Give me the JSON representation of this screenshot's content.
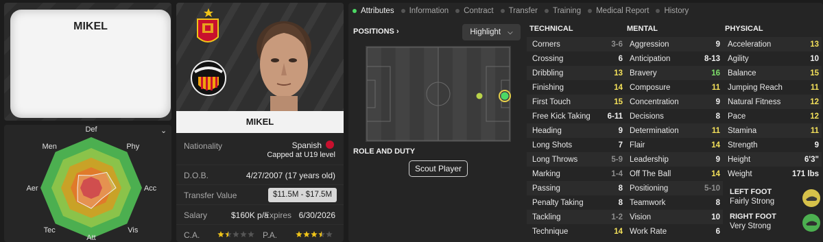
{
  "player": {
    "name": "MIKEL",
    "kit_name": "MIKEL"
  },
  "radar": {
    "labels": [
      "Def",
      "Phy",
      "Acc",
      "Vis",
      "Att",
      "Tec",
      "Aer",
      "Men"
    ]
  },
  "profile": {
    "nationality_label": "Nationality",
    "nationality_value": "Spanish",
    "nationality_note": "Capped at U19 level",
    "dob_label": "D.O.B.",
    "dob_value": "4/27/2007 (17 years old)",
    "transfer_label": "Transfer Value",
    "transfer_value": "$11.5M - $17.5M",
    "salary_label": "Salary",
    "salary_value": "$160K p/a",
    "expires_label": "Expires",
    "expires_value": "6/30/2026",
    "ca_label": "C.A.",
    "ca_stars": 1.5,
    "pa_label": "P.A.",
    "pa_stars": 3.5
  },
  "tabs": [
    "Attributes",
    "Information",
    "Contract",
    "Transfer",
    "Training",
    "Medical Report",
    "History"
  ],
  "active_tab": "Attributes",
  "positions": {
    "title": "POSITIONS",
    "highlight_label": "Highlight"
  },
  "role": {
    "title": "ROLE AND DUTY",
    "scout_label": "Scout Player"
  },
  "technical": {
    "title": "TECHNICAL",
    "rows": [
      {
        "name": "Corners",
        "value": "3-6",
        "tone": "grey"
      },
      {
        "name": "Crossing",
        "value": "6",
        "tone": "white"
      },
      {
        "name": "Dribbling",
        "value": "13",
        "tone": "yellow"
      },
      {
        "name": "Finishing",
        "value": "14",
        "tone": "yellow"
      },
      {
        "name": "First Touch",
        "value": "15",
        "tone": "yellow"
      },
      {
        "name": "Free Kick Taking",
        "value": "6-11",
        "tone": "white"
      },
      {
        "name": "Heading",
        "value": "9",
        "tone": "white"
      },
      {
        "name": "Long Shots",
        "value": "7",
        "tone": "white"
      },
      {
        "name": "Long Throws",
        "value": "5-9",
        "tone": "grey"
      },
      {
        "name": "Marking",
        "value": "1-4",
        "tone": "grey"
      },
      {
        "name": "Passing",
        "value": "8",
        "tone": "white"
      },
      {
        "name": "Penalty Taking",
        "value": "8",
        "tone": "white"
      },
      {
        "name": "Tackling",
        "value": "1-2",
        "tone": "grey"
      },
      {
        "name": "Technique",
        "value": "14",
        "tone": "yellow"
      }
    ]
  },
  "mental": {
    "title": "MENTAL",
    "rows": [
      {
        "name": "Aggression",
        "value": "9",
        "tone": "white"
      },
      {
        "name": "Anticipation",
        "value": "8-13",
        "tone": "white"
      },
      {
        "name": "Bravery",
        "value": "16",
        "tone": "green"
      },
      {
        "name": "Composure",
        "value": "11",
        "tone": "yellow"
      },
      {
        "name": "Concentration",
        "value": "9",
        "tone": "white"
      },
      {
        "name": "Decisions",
        "value": "8",
        "tone": "white"
      },
      {
        "name": "Determination",
        "value": "11",
        "tone": "yellow"
      },
      {
        "name": "Flair",
        "value": "14",
        "tone": "yellow"
      },
      {
        "name": "Leadership",
        "value": "9",
        "tone": "white"
      },
      {
        "name": "Off The Ball",
        "value": "14",
        "tone": "yellow"
      },
      {
        "name": "Positioning",
        "value": "5-10",
        "tone": "grey"
      },
      {
        "name": "Teamwork",
        "value": "8",
        "tone": "white"
      },
      {
        "name": "Vision",
        "value": "10",
        "tone": "white"
      },
      {
        "name": "Work Rate",
        "value": "6",
        "tone": "white"
      }
    ]
  },
  "physical": {
    "title": "PHYSICAL",
    "rows": [
      {
        "name": "Acceleration",
        "value": "13",
        "tone": "yellow"
      },
      {
        "name": "Agility",
        "value": "10",
        "tone": "white"
      },
      {
        "name": "Balance",
        "value": "15",
        "tone": "yellow"
      },
      {
        "name": "Jumping Reach",
        "value": "11",
        "tone": "yellow"
      },
      {
        "name": "Natural Fitness",
        "value": "12",
        "tone": "yellow"
      },
      {
        "name": "Pace",
        "value": "12",
        "tone": "yellow"
      },
      {
        "name": "Stamina",
        "value": "11",
        "tone": "yellow"
      },
      {
        "name": "Strength",
        "value": "9",
        "tone": "white"
      },
      {
        "name": "Height",
        "value": "6'3\"",
        "tone": "white"
      },
      {
        "name": "Weight",
        "value": "171 lbs",
        "tone": "white"
      }
    ]
  },
  "feet": {
    "left_title": "LEFT FOOT",
    "left_value": "Fairly Strong",
    "right_title": "RIGHT FOOT",
    "right_value": "Very Strong"
  },
  "colors": {
    "accent": "#4cd964",
    "yellow": "#f3e05a",
    "green": "#7ee06a"
  }
}
